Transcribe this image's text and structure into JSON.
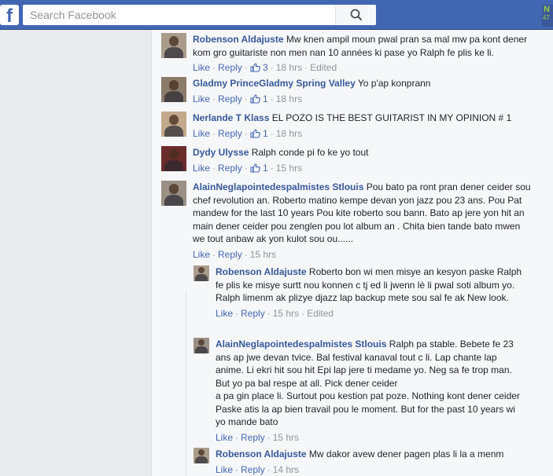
{
  "topbar": {
    "logo": "f",
    "search_placeholder": "Search Facebook",
    "badge_top": "N",
    "badge_bottom": "47"
  },
  "actions": {
    "like": "Like",
    "reply": "Reply",
    "edited": "Edited"
  },
  "comments": [
    {
      "author": "Robenson Aldajuste",
      "text": "Mw knen ampil moun pwal pran sa mal mw pa kont dener kom gro guitariste non men nan 10 années ki pase yo Ralph fe plis ke li.",
      "likes": "3",
      "time": "18 hrs",
      "edited": true
    },
    {
      "author": "Gladmy PrinceGladmy Spring Valley",
      "text": "Yo p'ap konprann",
      "likes": "1",
      "time": "18 hrs"
    },
    {
      "author": "Nerlande T Klass",
      "text": "EL POZO IS THE BEST GUITARIST IN MY OPINION # 1",
      "likes": "1",
      "time": "18 hrs"
    },
    {
      "author": "Dydy Ulysse",
      "text": "Ralph conde pi fo ke yo tout",
      "likes": "1",
      "time": "15 hrs"
    },
    {
      "author": "AlainNeglapointedespalmistes Stlouis",
      "text": "Pou bato pa ront pran dener ceider sou chef revolution an. Roberto matino kempe devan yon jazz pou 23 ans. Pou Pat mandew for the last 10 years Pou kite roberto sou bann. Bato ap jere yon hit an main dener ceider pou zenglen pou lot album an . Chita bien tande bato mwen we tout anbaw ak yon kulot sou ou......",
      "time": "15 hrs"
    }
  ],
  "replies": [
    {
      "author": "Robenson Aldajuste",
      "text": "Roberto bon wi men misye an kesyon paske Ralph fe plis ke misye surtt nou konnen c tj ed li jwenn lè li pwal soti album yo. Ralph limenm ak plizye djazz lap backup mete sou sal fe ak New look.",
      "time": "15 hrs",
      "edited": true
    },
    {
      "author": "AlainNeglapointedespalmistes Stlouis",
      "text": "Ralph pa stable. Bebete fe 23 ans ap jwe devan tvice. Bal festival kanaval tout c li. Lap chante lap anime. Li ekri hit sou hit Epi lap jere ti medame yo. Neg sa fe trop man. But yo pa bal respe at all. Pick dener ceider\na pa gin place li. Surtout pou kestion pat poze. Nothing kont dener ceider Paske atis la ap bien travail pou le moment. But for the past 10 years wi yo mande bato",
      "time": "15 hrs"
    },
    {
      "author": "Robenson Aldajuste",
      "text": "Mw dakor avew dener pagen plas li la a menm",
      "time": "14 hrs"
    }
  ]
}
